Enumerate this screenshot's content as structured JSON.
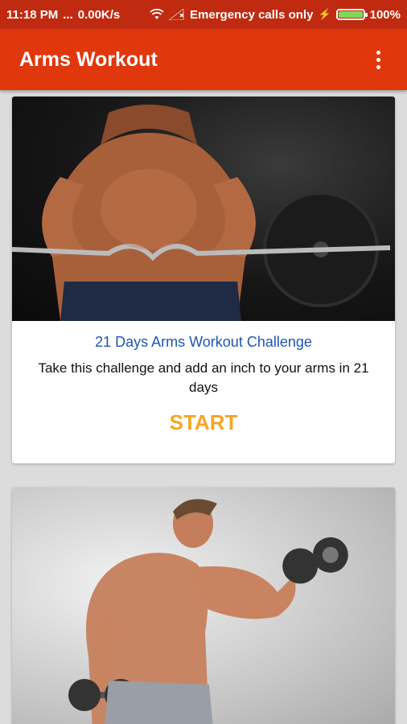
{
  "status_bar": {
    "time": "11:18 PM",
    "dots": "...",
    "net_speed": "0.00K/s",
    "carrier": "Emergency calls only",
    "battery": "100%"
  },
  "app_bar": {
    "title": "Arms Workout"
  },
  "cards": [
    {
      "title": "21 Days Arms Workout Challenge",
      "description": "Take this challenge and add an inch to your arms in 21 days",
      "button": "START"
    }
  ],
  "colors": {
    "status_bar": "#c02a10",
    "app_bar": "#e0370d",
    "title_blue": "#1e55b3",
    "start_orange": "#f5a623",
    "battery_green": "#7ed957"
  },
  "icons": [
    "wifi-icon",
    "signal-icon",
    "charging-icon",
    "battery-icon",
    "overflow-menu-icon"
  ]
}
